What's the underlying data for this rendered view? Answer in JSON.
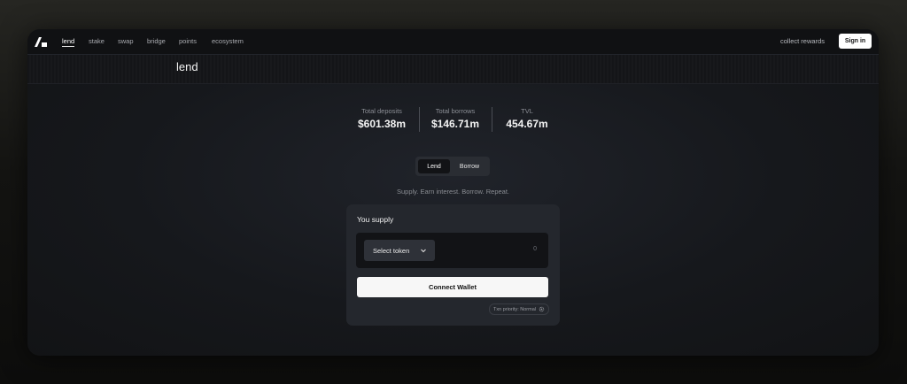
{
  "navbar": {
    "links": [
      {
        "label": "lend",
        "active": true
      },
      {
        "label": "stake"
      },
      {
        "label": "swap"
      },
      {
        "label": "bridge"
      },
      {
        "label": "points"
      },
      {
        "label": "ecosystem"
      }
    ],
    "collect_rewards": "collect rewards",
    "sign_in": "Sign in"
  },
  "page": {
    "title": "lend"
  },
  "stats": [
    {
      "label": "Total deposits",
      "value": "$601.38m"
    },
    {
      "label": "Total borrows",
      "value": "$146.71m"
    },
    {
      "label": "TVL",
      "value": "454.67m"
    }
  ],
  "toggle": {
    "lend": "Lend",
    "borrow": "Borrow",
    "active": "Lend"
  },
  "tagline": "Supply. Earn interest. Borrow. Repeat.",
  "supply_card": {
    "title": "You supply",
    "select_token": "Select token",
    "amount": "0",
    "connect_wallet": "Connect Wallet",
    "tx_priority": "Txn priority: Normal"
  },
  "icons": [
    "logo-icon",
    "chevron-down-icon",
    "gear-icon"
  ]
}
